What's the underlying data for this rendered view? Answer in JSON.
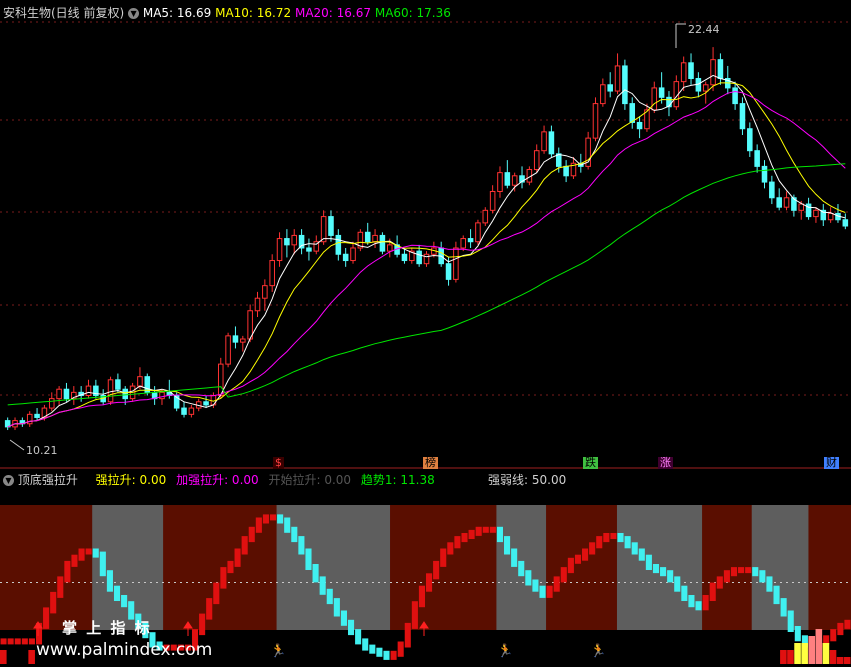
{
  "header": {
    "stock": "安科生物(日线 前复权)",
    "chevron_icon": "chevron-down-icon",
    "ma5": "MA5: 16.69",
    "ma10": "MA10: 16.72",
    "ma20": "MA20: 16.67",
    "ma60": "MA60: 17.36"
  },
  "markers": [
    {
      "text": "$",
      "color": "#ff4040",
      "bg": "#3a0000"
    },
    {
      "text": "榜",
      "color": "#000000",
      "bg": "#e08040"
    },
    {
      "text": "跌",
      "color": "#000000",
      "bg": "#40c040"
    },
    {
      "text": "涨",
      "color": "#ff80ff",
      "bg": "#400030"
    },
    {
      "text": "财",
      "color": "#000000",
      "bg": "#4080ff"
    }
  ],
  "indicator": {
    "name": "顶底强拉升",
    "chevron_icon": "chevron-down-icon",
    "qls": "强拉升: 0.00",
    "jqls": "加强拉升: 0.00",
    "ksls": "开始拉升: 0.00",
    "trend": "趋势1: 11.38",
    "weak": "强弱线: 50.00"
  },
  "watermark": {
    "cn": "掌 上 指 标",
    "url": "www.palmindex.com"
  },
  "colors": {
    "up": "#ff3232",
    "down": "#54fcfc",
    "ma5": "#ffffff",
    "ma10": "#ffff00",
    "ma20": "#ff00ff",
    "ma60": "#00e600"
  },
  "chart_data": {
    "type": "candlestick",
    "price_range": [
      9.5,
      23.2
    ],
    "high_label": "22.44",
    "low_label": "10.21",
    "ohlc": [
      [
        10.5,
        10.6,
        10.2,
        10.3
      ],
      [
        10.3,
        10.6,
        10.2,
        10.5
      ],
      [
        10.5,
        10.6,
        10.3,
        10.4
      ],
      [
        10.4,
        10.8,
        10.3,
        10.7
      ],
      [
        10.7,
        10.9,
        10.5,
        10.6
      ],
      [
        10.6,
        11.0,
        10.5,
        10.9
      ],
      [
        10.9,
        11.4,
        10.8,
        11.2
      ],
      [
        11.2,
        11.6,
        11.0,
        11.5
      ],
      [
        11.5,
        11.7,
        11.1,
        11.2
      ],
      [
        11.2,
        11.6,
        11.0,
        11.4
      ],
      [
        11.4,
        11.6,
        11.1,
        11.3
      ],
      [
        11.3,
        11.8,
        11.2,
        11.6
      ],
      [
        11.6,
        11.8,
        11.2,
        11.3
      ],
      [
        11.3,
        11.5,
        11.0,
        11.1
      ],
      [
        11.1,
        11.9,
        11.0,
        11.8
      ],
      [
        11.8,
        12.0,
        11.4,
        11.5
      ],
      [
        11.5,
        11.6,
        11.0,
        11.2
      ],
      [
        11.2,
        11.7,
        11.1,
        11.6
      ],
      [
        11.6,
        12.2,
        11.5,
        11.9
      ],
      [
        11.9,
        12.0,
        11.3,
        11.4
      ],
      [
        11.4,
        11.6,
        11.0,
        11.2
      ],
      [
        11.2,
        11.5,
        11.0,
        11.4
      ],
      [
        11.4,
        11.8,
        11.2,
        11.3
      ],
      [
        11.3,
        11.4,
        10.8,
        10.9
      ],
      [
        10.9,
        11.1,
        10.6,
        10.7
      ],
      [
        10.7,
        11.0,
        10.6,
        10.9
      ],
      [
        10.9,
        11.2,
        10.8,
        11.1
      ],
      [
        11.1,
        11.3,
        10.9,
        11.0
      ],
      [
        11.0,
        11.4,
        10.9,
        11.3
      ],
      [
        11.3,
        12.5,
        11.2,
        12.3
      ],
      [
        12.3,
        13.3,
        12.2,
        13.2
      ],
      [
        13.2,
        13.5,
        12.8,
        13.0
      ],
      [
        13.0,
        13.2,
        12.7,
        13.1
      ],
      [
        13.1,
        14.2,
        13.0,
        14.0
      ],
      [
        14.0,
        14.6,
        13.8,
        14.4
      ],
      [
        14.4,
        15.0,
        14.0,
        14.8
      ],
      [
        14.8,
        15.8,
        14.6,
        15.6
      ],
      [
        15.6,
        16.5,
        15.4,
        16.3
      ],
      [
        16.3,
        16.6,
        15.7,
        16.1
      ],
      [
        16.1,
        16.6,
        15.8,
        16.4
      ],
      [
        16.4,
        16.6,
        15.8,
        16.0
      ],
      [
        16.0,
        16.3,
        15.6,
        15.9
      ],
      [
        15.9,
        16.4,
        15.8,
        16.2
      ],
      [
        16.2,
        17.2,
        16.1,
        17.0
      ],
      [
        17.0,
        17.2,
        16.2,
        16.4
      ],
      [
        16.4,
        16.6,
        15.6,
        15.8
      ],
      [
        15.8,
        16.0,
        15.4,
        15.6
      ],
      [
        15.6,
        16.2,
        15.5,
        16.0
      ],
      [
        16.0,
        16.6,
        15.9,
        16.5
      ],
      [
        16.5,
        16.8,
        16.1,
        16.2
      ],
      [
        16.2,
        16.6,
        16.0,
        16.4
      ],
      [
        16.4,
        16.5,
        15.8,
        15.9
      ],
      [
        15.9,
        16.3,
        15.7,
        16.1
      ],
      [
        16.1,
        16.4,
        15.7,
        15.8
      ],
      [
        15.8,
        16.0,
        15.5,
        15.6
      ],
      [
        15.6,
        16.0,
        15.5,
        15.9
      ],
      [
        15.9,
        16.1,
        15.4,
        15.5
      ],
      [
        15.5,
        15.9,
        15.4,
        15.8
      ],
      [
        15.8,
        16.2,
        15.7,
        16.0
      ],
      [
        16.0,
        16.2,
        15.4,
        15.5
      ],
      [
        15.5,
        15.7,
        14.8,
        15.0
      ],
      [
        15.0,
        16.2,
        14.9,
        16.0
      ],
      [
        16.0,
        16.4,
        15.9,
        16.3
      ],
      [
        16.3,
        16.6,
        16.0,
        16.2
      ],
      [
        16.2,
        16.9,
        16.1,
        16.8
      ],
      [
        16.8,
        17.3,
        16.7,
        17.2
      ],
      [
        17.2,
        18.0,
        17.1,
        17.8
      ],
      [
        17.8,
        18.6,
        17.6,
        18.4
      ],
      [
        18.4,
        18.8,
        17.9,
        18.0
      ],
      [
        18.0,
        18.4,
        17.8,
        18.3
      ],
      [
        18.3,
        18.6,
        17.9,
        18.1
      ],
      [
        18.1,
        18.6,
        18.0,
        18.5
      ],
      [
        18.5,
        19.3,
        18.4,
        19.1
      ],
      [
        19.1,
        19.9,
        19.0,
        19.7
      ],
      [
        19.7,
        19.9,
        18.9,
        19.0
      ],
      [
        19.0,
        19.2,
        18.4,
        18.6
      ],
      [
        18.6,
        18.8,
        18.1,
        18.3
      ],
      [
        18.3,
        18.9,
        18.2,
        18.7
      ],
      [
        18.7,
        19.0,
        18.4,
        18.6
      ],
      [
        18.6,
        19.7,
        18.5,
        19.5
      ],
      [
        19.5,
        20.8,
        19.4,
        20.6
      ],
      [
        20.6,
        21.4,
        20.5,
        21.2
      ],
      [
        21.2,
        21.6,
        20.8,
        21.0
      ],
      [
        21.0,
        22.2,
        20.9,
        21.8
      ],
      [
        21.8,
        22.0,
        20.4,
        20.6
      ],
      [
        20.6,
        20.8,
        19.8,
        20.0
      ],
      [
        20.0,
        20.2,
        19.5,
        19.8
      ],
      [
        19.8,
        20.6,
        19.7,
        20.4
      ],
      [
        20.4,
        21.3,
        20.3,
        21.1
      ],
      [
        21.1,
        21.6,
        20.6,
        20.8
      ],
      [
        20.8,
        21.0,
        20.2,
        20.5
      ],
      [
        20.5,
        21.5,
        20.4,
        21.3
      ],
      [
        21.3,
        22.1,
        21.0,
        21.9
      ],
      [
        21.9,
        22.2,
        21.2,
        21.4
      ],
      [
        21.4,
        21.6,
        20.8,
        21.0
      ],
      [
        21.0,
        21.3,
        20.6,
        21.2
      ],
      [
        21.2,
        22.4,
        21.0,
        22.0
      ],
      [
        22.0,
        22.2,
        21.2,
        21.4
      ],
      [
        21.4,
        21.8,
        20.9,
        21.1
      ],
      [
        21.1,
        21.3,
        20.4,
        20.6
      ],
      [
        20.6,
        20.8,
        19.6,
        19.8
      ],
      [
        19.8,
        20.0,
        18.9,
        19.1
      ],
      [
        19.1,
        19.3,
        18.4,
        18.6
      ],
      [
        18.6,
        18.8,
        17.9,
        18.1
      ],
      [
        18.1,
        18.3,
        17.4,
        17.6
      ],
      [
        17.6,
        17.9,
        17.2,
        17.3
      ],
      [
        17.3,
        17.8,
        17.2,
        17.6
      ],
      [
        17.6,
        17.7,
        17.0,
        17.2
      ],
      [
        17.2,
        17.5,
        16.9,
        17.4
      ],
      [
        17.4,
        17.6,
        16.9,
        17.0
      ],
      [
        17.0,
        17.3,
        16.8,
        17.2
      ],
      [
        17.2,
        17.4,
        16.7,
        16.9
      ],
      [
        16.9,
        17.3,
        16.8,
        17.1
      ],
      [
        17.1,
        17.4,
        16.8,
        16.9
      ],
      [
        16.9,
        17.1,
        16.6,
        16.7
      ]
    ],
    "indicator_series": {
      "range": [
        0,
        100
      ],
      "weak_line": 50,
      "trend": [
        12,
        12,
        12,
        12,
        12,
        22,
        32,
        42,
        52,
        62,
        66,
        70,
        70,
        68,
        56,
        46,
        40,
        36,
        28,
        22,
        16,
        10,
        8,
        8,
        8,
        8,
        8,
        18,
        28,
        38,
        48,
        58,
        62,
        70,
        78,
        84,
        90,
        92,
        92,
        90,
        84,
        78,
        70,
        60,
        52,
        44,
        38,
        30,
        24,
        18,
        12,
        8,
        6,
        4,
        2,
        4,
        10,
        22,
        36,
        46,
        54,
        62,
        70,
        74,
        78,
        80,
        82,
        84,
        84,
        84,
        78,
        70,
        62,
        56,
        50,
        46,
        42,
        46,
        52,
        58,
        64,
        66,
        70,
        74,
        78,
        80,
        80,
        78,
        74,
        70,
        66,
        60,
        58,
        56,
        52,
        46,
        40,
        36,
        34,
        40,
        48,
        52,
        56,
        58,
        58,
        58,
        56,
        52,
        46,
        38,
        30,
        20,
        14,
        10,
        10,
        12,
        14,
        18,
        22,
        24
      ],
      "bars": [
        2,
        0,
        0,
        0,
        2,
        0,
        0,
        0,
        0,
        0,
        0,
        0,
        0,
        0,
        0,
        0,
        0,
        0,
        0,
        0,
        0,
        0,
        0,
        0,
        0,
        0,
        0,
        0,
        0,
        0,
        0,
        0,
        0,
        0,
        0,
        0,
        0,
        0,
        0,
        0,
        0,
        0,
        0,
        0,
        0,
        0,
        0,
        0,
        0,
        0,
        0,
        0,
        0,
        0,
        0,
        0,
        0,
        0,
        0,
        0,
        0,
        0,
        0,
        0,
        0,
        0,
        0,
        0,
        0,
        0,
        0,
        0,
        0,
        0,
        0,
        0,
        0,
        0,
        0,
        0,
        0,
        0,
        0,
        0,
        0,
        0,
        0,
        0,
        0,
        0,
        0,
        0,
        0,
        0,
        0,
        0,
        0,
        0,
        0,
        0,
        0,
        0,
        0,
        0,
        0,
        0,
        0,
        0,
        0,
        0,
        2,
        2,
        3,
        3,
        4,
        5,
        3,
        2,
        1,
        1
      ]
    }
  }
}
